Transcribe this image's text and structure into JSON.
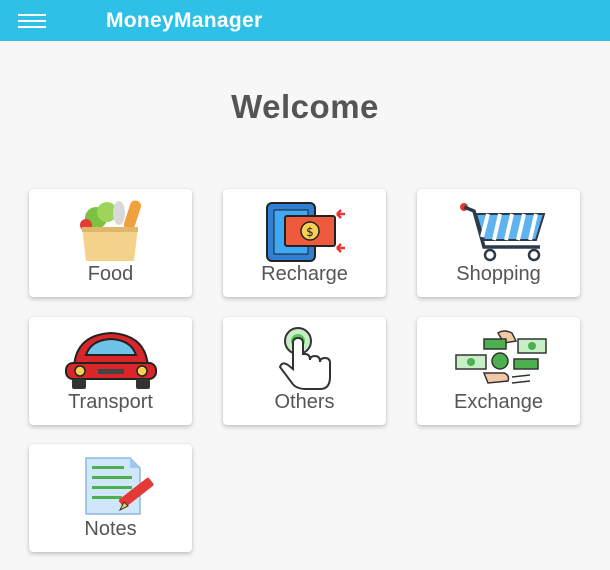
{
  "app": {
    "title": "MoneyManager"
  },
  "main": {
    "heading": "Welcome",
    "tiles": [
      {
        "label": "Food",
        "icon": "grocery-bag-icon"
      },
      {
        "label": "Recharge",
        "icon": "mobile-recharge-icon"
      },
      {
        "label": "Shopping",
        "icon": "shopping-cart-icon"
      },
      {
        "label": "Transport",
        "icon": "car-icon"
      },
      {
        "label": "Others",
        "icon": "tap-hand-icon"
      },
      {
        "label": "Exchange",
        "icon": "money-exchange-icon"
      },
      {
        "label": "Notes",
        "icon": "notes-pen-icon"
      }
    ]
  },
  "colors": {
    "appbar": "#2ec0e6",
    "background": "#f7f7f7",
    "card": "#ffffff",
    "text": "#555555"
  }
}
